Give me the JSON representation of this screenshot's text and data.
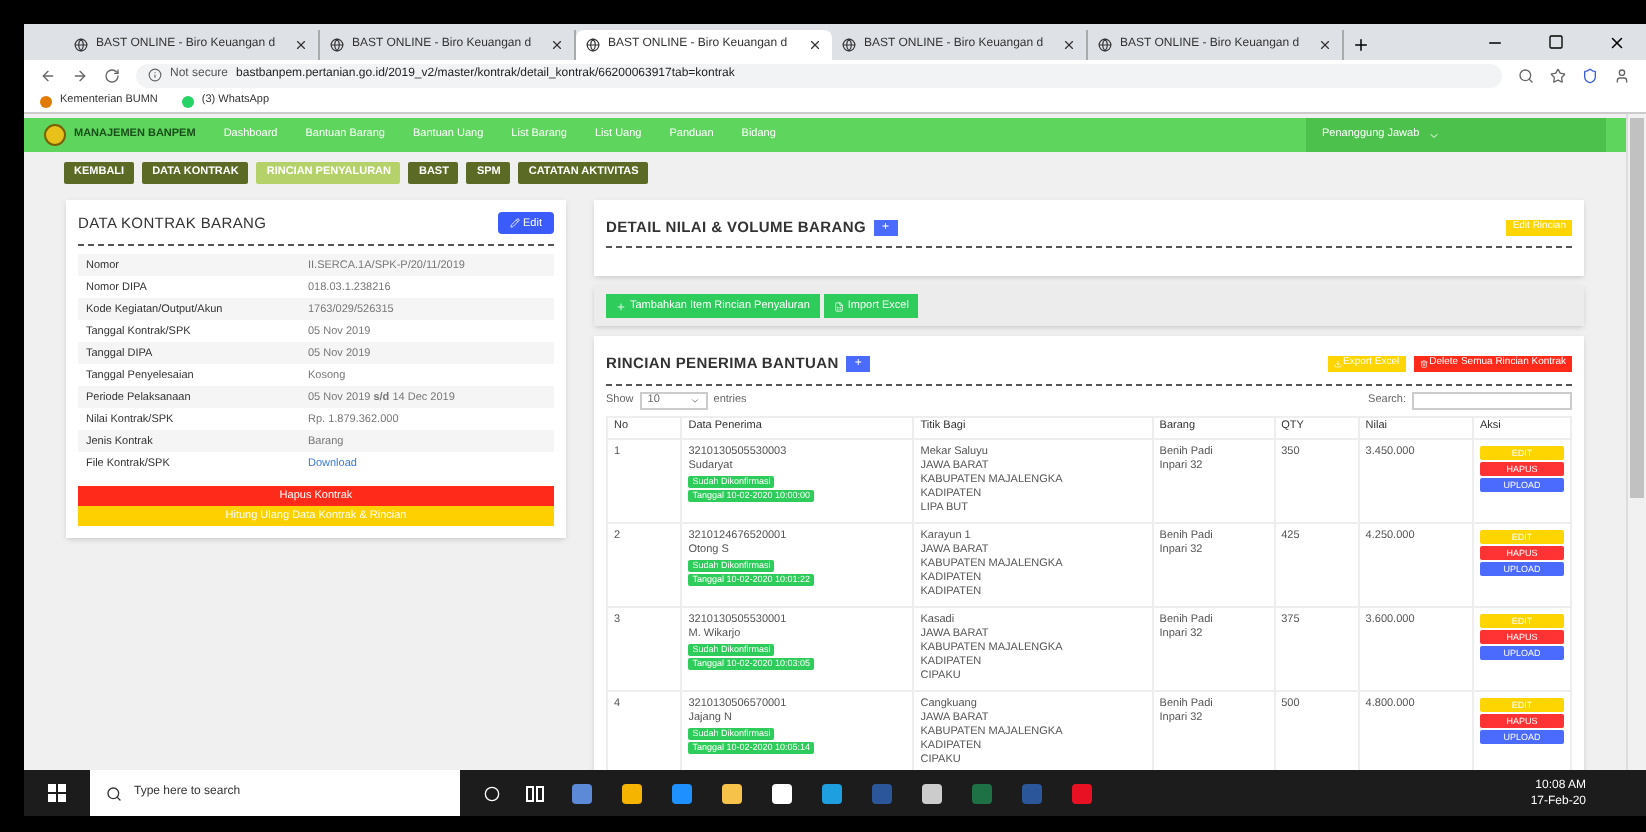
{
  "browser": {
    "tabs": [
      {
        "title": "BAST ONLINE - Biro Keuangan d",
        "selected": false
      },
      {
        "title": "BAST ONLINE - Biro Keuangan d",
        "selected": false
      },
      {
        "title": "BAST ONLINE - Biro Keuangan d",
        "selected": true
      },
      {
        "title": "BAST ONLINE - Biro Keuangan d",
        "selected": false
      },
      {
        "title": "BAST ONLINE - Biro Keuangan d",
        "selected": false
      }
    ],
    "security": "Not secure",
    "url": "bastbanpem.pertanian.go.id/2019_v2/master/kontrak/detail_kontrak/66200063917tab=kontrak",
    "bookmarks": [
      "Kementerian BUMN",
      "(3) WhatsApp"
    ]
  },
  "nav": {
    "brand": "MANAJEMEN BANPEM",
    "items": [
      "Dashboard",
      "Bantuan Barang",
      "Bantuan Uang",
      "List Barang",
      "List Uang",
      "Panduan",
      "Bidang"
    ],
    "user": "Penanggung Jawab"
  },
  "action_buttons": [
    {
      "label": "KEMBALI",
      "selected": false
    },
    {
      "label": "DATA KONTRAK",
      "selected": false
    },
    {
      "label": "RINCIAN PENYALURAN",
      "selected": true
    },
    {
      "label": "BAST",
      "selected": false
    },
    {
      "label": "SPM",
      "selected": false
    },
    {
      "label": "CATATAN AKTIVITAS",
      "selected": false
    }
  ],
  "contract": {
    "title": "DATA KONTRAK BARANG",
    "edit": "Edit",
    "rows": [
      {
        "label": "Nomor",
        "value": "II.SERCA.1A/SPK-P/20/11/2019",
        "kind": "text"
      },
      {
        "label": "Nomor DIPA",
        "value": "018.03.1.238216",
        "kind": "text"
      },
      {
        "label": "Kode Kegiatan/Output/Akun",
        "value": "1763/029/526315",
        "kind": "text"
      },
      {
        "label": "Tanggal Kontrak/SPK",
        "value": "05 Nov 2019",
        "kind": "text"
      },
      {
        "label": "Tanggal DIPA",
        "value": "05 Nov 2019",
        "kind": "text"
      },
      {
        "label": "Tanggal Penyelesaian",
        "value": "Kosong",
        "kind": "text"
      },
      {
        "label": "Periode Pelaksanaan",
        "value": "05 Nov 2019 **s/d** 14 Dec 2019",
        "kind": "text"
      },
      {
        "label": "Nilai Kontrak/SPK",
        "value": "Rp. 1.879.362.000",
        "kind": "text"
      },
      {
        "label": "Jenis Kontrak",
        "value": "Barang",
        "kind": "text"
      },
      {
        "label": "File Kontrak/SPK",
        "value": "Download",
        "kind": "link"
      }
    ],
    "buttons": [
      {
        "label": "Hapus Kontrak",
        "kind": "danger"
      },
      {
        "label": "Hitung Ulang Data Kontrak & Rincian",
        "kind": "warning"
      }
    ]
  },
  "detail": {
    "title": "DETAIL NILAI & VOLUME BARANG",
    "badge": "+",
    "edit": "Edit Rincian"
  },
  "tools": [
    "Tambahkan Item Rincian Penyaluran",
    "Import Excel"
  ],
  "recipients": {
    "title": "RINCIAN PENERIMA BANTUAN",
    "badge": "+",
    "export": "Export Excel",
    "delete": "Delete Semua Rincian Kontrak",
    "show": "Show",
    "page_size": "10",
    "entries": "entries",
    "search": "Search:",
    "columns": [
      "No",
      "Data Penerima",
      "Titik Bagi",
      "Barang",
      "QTY",
      "Nilai",
      "Aksi"
    ],
    "rows": [
      {
        "no": "1",
        "id": "3210130505530003",
        "name": "Sudaryat",
        "status": "Sudah Dikonfirmasi",
        "date": "Tanggal 10-02-2020 10:00:00",
        "place": [
          "Mekar Saluyu",
          "JAWA BARAT",
          "KABUPATEN MAJALENGKA",
          "KADIPATEN",
          "LIPA BUT"
        ],
        "item": [
          "Benih Padi",
          "Inpari 32"
        ],
        "qty": "350",
        "value": "3.450.000",
        "actions": [
          "EDIT",
          "HAPUS",
          "UPLOAD"
        ]
      },
      {
        "no": "2",
        "id": "3210124676520001",
        "name": "Otong S",
        "status": "Sudah Dikonfirmasi",
        "date": "Tanggal 10-02-2020 10:01:22",
        "place": [
          "Karayun 1",
          "JAWA BARAT",
          "KABUPATEN MAJALENGKA",
          "KADIPATEN",
          "KADIPATEN"
        ],
        "item": [
          "Benih Padi",
          "Inpari 32"
        ],
        "qty": "425",
        "value": "4.250.000",
        "actions": [
          "EDIT",
          "HAPUS",
          "UPLOAD"
        ]
      },
      {
        "no": "3",
        "id": "3210130505530001",
        "name": "M. Wikarjo",
        "status": "Sudah Dikonfirmasi",
        "date": "Tanggal 10-02-2020 10:03:05",
        "place": [
          "Kasadi",
          "JAWA BARAT",
          "KABUPATEN MAJALENGKA",
          "KADIPATEN",
          "CIPAKU"
        ],
        "item": [
          "Benih Padi",
          "Inpari 32"
        ],
        "qty": "375",
        "value": "3.600.000",
        "actions": [
          "EDIT",
          "HAPUS",
          "UPLOAD"
        ]
      },
      {
        "no": "4",
        "id": "3210130506570001",
        "name": "Jajang N",
        "status": "Sudah Dikonfirmasi",
        "date": "Tanggal 10-02-2020 10:05:14",
        "place": [
          "Cangkuang",
          "JAWA BARAT",
          "KABUPATEN MAJALENGKA",
          "KADIPATEN",
          "CIPAKU"
        ],
        "item": [
          "Benih Padi",
          "Inpari 32"
        ],
        "qty": "500",
        "value": "4.800.000",
        "actions": [
          "EDIT",
          "HAPUS",
          "UPLOAD"
        ]
      }
    ]
  },
  "taskbar": {
    "search": "Type here to search",
    "time": "10:08 AM",
    "date": "17-Feb-20"
  }
}
